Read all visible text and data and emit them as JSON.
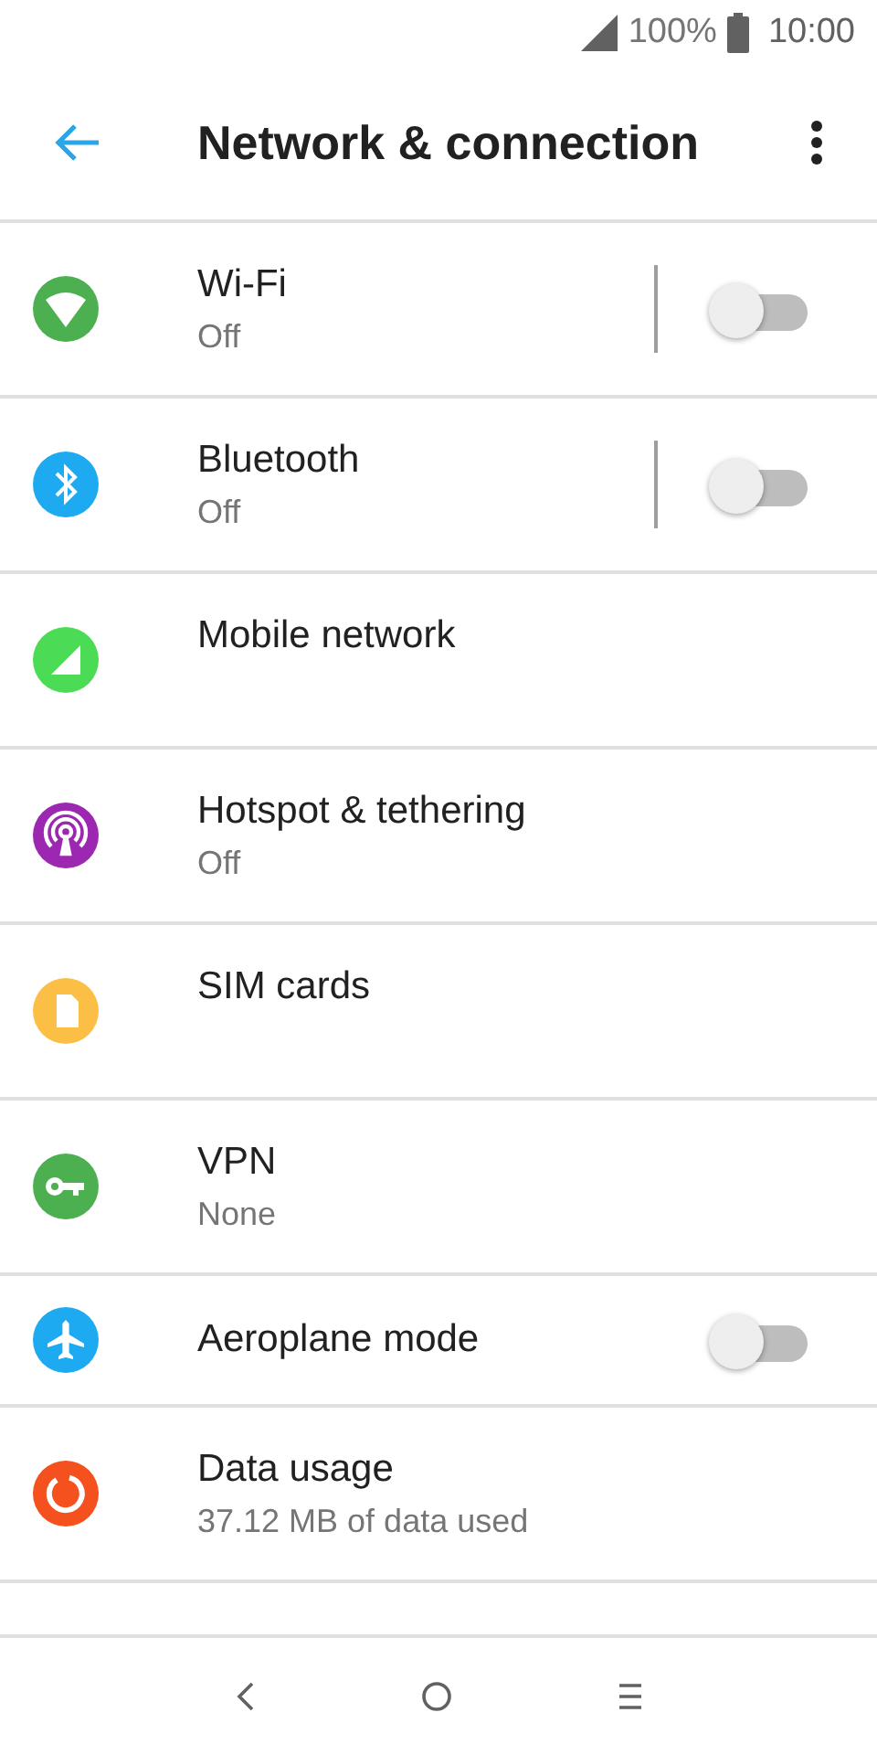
{
  "status_bar": {
    "battery": "100%",
    "time": "10:00"
  },
  "app_bar": {
    "title": "Network & connection"
  },
  "items": [
    {
      "title": "Wi-Fi",
      "subtitle": "Off",
      "kind": "split-toggle",
      "on": false,
      "color": "#4caf50"
    },
    {
      "title": "Bluetooth",
      "subtitle": "Off",
      "kind": "split-toggle",
      "on": false,
      "color": "#1eaaf1"
    },
    {
      "title": "Mobile network",
      "kind": "link",
      "color": "#4cdb55"
    },
    {
      "title": "Hotspot & tethering",
      "subtitle": "Off",
      "kind": "link",
      "color": "#9c27b0"
    },
    {
      "title": "SIM cards",
      "kind": "link",
      "color": "#fbbf45"
    },
    {
      "title": "VPN",
      "subtitle": "None",
      "kind": "link",
      "color": "#4caf50"
    },
    {
      "title": "Aeroplane mode",
      "kind": "toggle",
      "on": false,
      "color": "#1eaaf1"
    },
    {
      "title": "Data usage",
      "subtitle": "37.12 MB of data used",
      "kind": "link",
      "color": "#f4511e"
    }
  ]
}
